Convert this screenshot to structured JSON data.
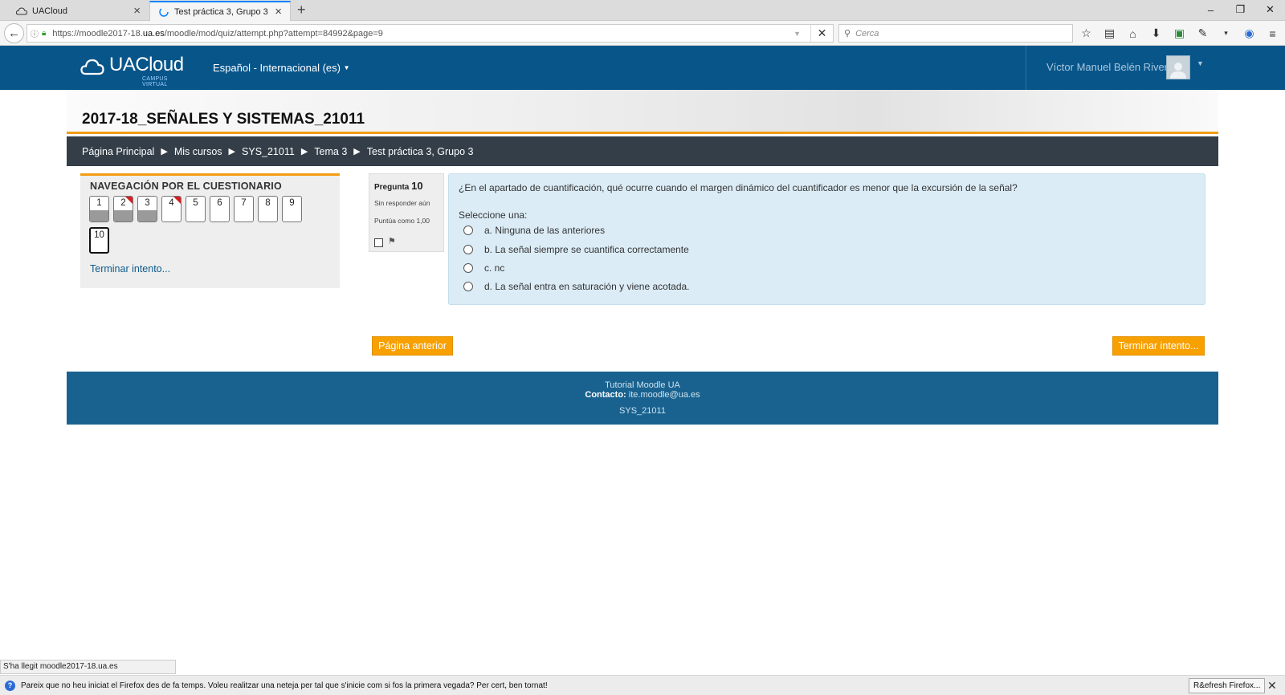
{
  "browser": {
    "tabs": [
      {
        "label": "UACloud",
        "active": false
      },
      {
        "label": "Test práctica 3, Grupo 3",
        "active": true
      }
    ],
    "url_prefix": "https://moodle2017-18.",
    "url_domain": "ua.es",
    "url_suffix": "/moodle/mod/quiz/attempt.php?attempt=84992&page=9",
    "search_placeholder": "Cerca",
    "status_text": "S'ha llegit moodle2017-18.ua.es",
    "notice_text": "Pareix que no heu iniciat el Firefox des de fa temps. Voleu realitzar una neteja per tal que s'inicie com si fos la primera vegada? Per cert, ben tornat!",
    "notice_button": "R&efresh Firefox..."
  },
  "header": {
    "logo": "UACloud",
    "logo_sub": "CAMPUS VIRTUAL",
    "language": "Español - Internacional (es)",
    "user_name": "Víctor Manuel Belén Rivera"
  },
  "course": {
    "title": "2017-18_SEÑALES Y SISTEMAS_21011",
    "breadcrumb": [
      "Página Principal",
      "Mis cursos",
      "SYS_21011",
      "Tema 3",
      "Test práctica 3, Grupo 3"
    ]
  },
  "quiz_nav": {
    "title": "NAVEGACIÓN POR EL CUESTIONARIO",
    "questions": [
      {
        "n": "1",
        "state": "answered"
      },
      {
        "n": "2",
        "state": "answered-flagged"
      },
      {
        "n": "3",
        "state": "answered"
      },
      {
        "n": "4",
        "state": "flagged"
      },
      {
        "n": "5",
        "state": "empty"
      },
      {
        "n": "6",
        "state": "empty"
      },
      {
        "n": "7",
        "state": "empty"
      },
      {
        "n": "8",
        "state": "empty"
      },
      {
        "n": "9",
        "state": "empty"
      },
      {
        "n": "10",
        "state": "current"
      }
    ],
    "finish_link": "Terminar intento..."
  },
  "question": {
    "label": "Pregunta",
    "number": "10",
    "state": "Sin responder aún",
    "grade": "Puntúa como 1,00",
    "text": "¿En el apartado de cuantificación, qué ocurre cuando el margen dinámico del cuantificador es menor que la excursión de la señal?",
    "prompt": "Seleccione una:",
    "options": [
      "a. Ninguna de las anteriores",
      "b. La señal siempre se cuantifica correctamente",
      "c. nc",
      "d. La señal entra en saturación y viene acotada."
    ]
  },
  "buttons": {
    "previous": "Página anterior",
    "finish": "Terminar intento..."
  },
  "footer": {
    "line1": "Tutorial Moodle UA",
    "contact_label": "Contacto:",
    "contact_email": "ite.moodle@ua.es",
    "course_code": "SYS_21011"
  },
  "colors": {
    "header_blue": "#08558a",
    "accent_orange": "#f39c12",
    "button_orange": "#f7a000",
    "breadcrumb_dark": "#333e48",
    "question_bg": "#dbecf6",
    "footer_blue": "#19628f",
    "flag_red": "#d42020"
  }
}
